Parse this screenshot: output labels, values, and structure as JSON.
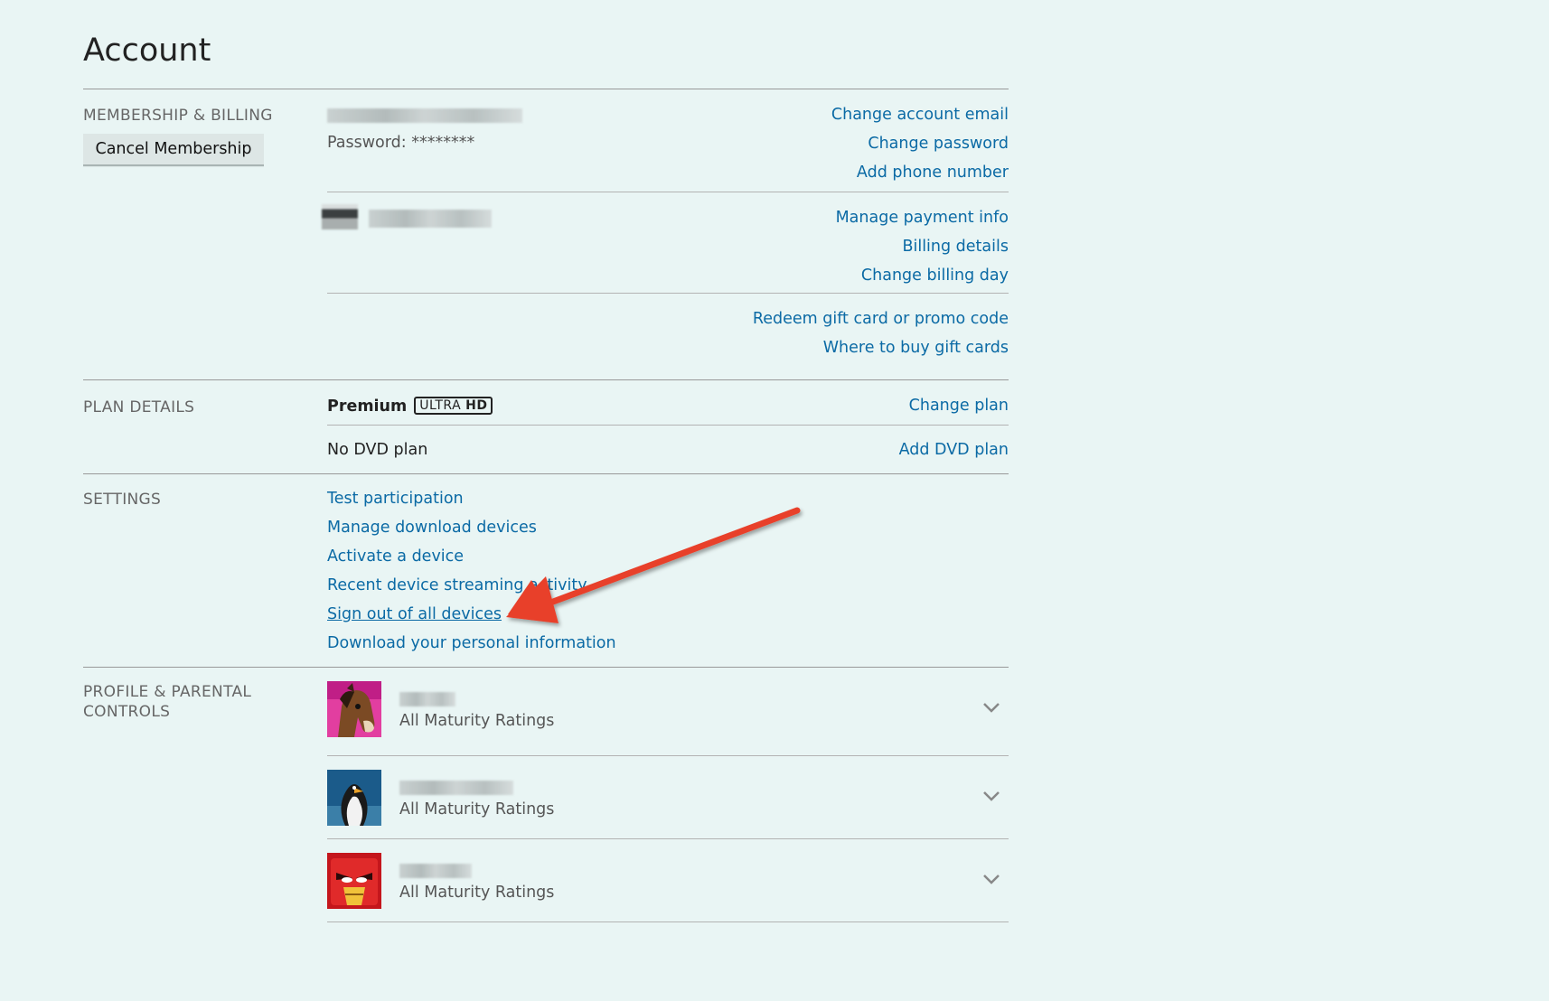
{
  "page": {
    "title": "Account"
  },
  "membership": {
    "section_label": "MEMBERSHIP & BILLING",
    "cancel_button": "Cancel Membership",
    "password": "Password: ********",
    "account_links": [
      "Change account email",
      "Change password",
      "Add phone number"
    ],
    "payment_links": [
      "Manage payment info",
      "Billing details",
      "Change billing day"
    ],
    "gift_links": [
      "Redeem gift card or promo code",
      "Where to buy gift cards"
    ]
  },
  "plan": {
    "section_label": "PLAN DETAILS",
    "plan_name": "Premium",
    "badge_thin": "ULTRA",
    "badge_bold": "HD",
    "change_plan": "Change plan",
    "dvd_status": "No DVD plan",
    "add_dvd": "Add DVD plan"
  },
  "settings": {
    "section_label": "SETTINGS",
    "links": [
      "Test participation",
      "Manage download devices",
      "Activate a device",
      "Recent device streaming activity",
      "Sign out of all devices",
      "Download your personal information"
    ]
  },
  "profiles": {
    "section_label_line1": "PROFILE & PARENTAL",
    "section_label_line2": "CONTROLS",
    "items": [
      {
        "rating": "All Maturity Ratings",
        "avatar_icon": "horse-avatar-icon"
      },
      {
        "rating": "All Maturity Ratings",
        "avatar_icon": "penguin-avatar-icon"
      },
      {
        "rating": "All Maturity Ratings",
        "avatar_icon": "red-bird-avatar-icon"
      }
    ]
  },
  "colors": {
    "link": "#0b6aa5",
    "background": "#e9f5f4",
    "annotation_arrow": "#e8412c"
  }
}
